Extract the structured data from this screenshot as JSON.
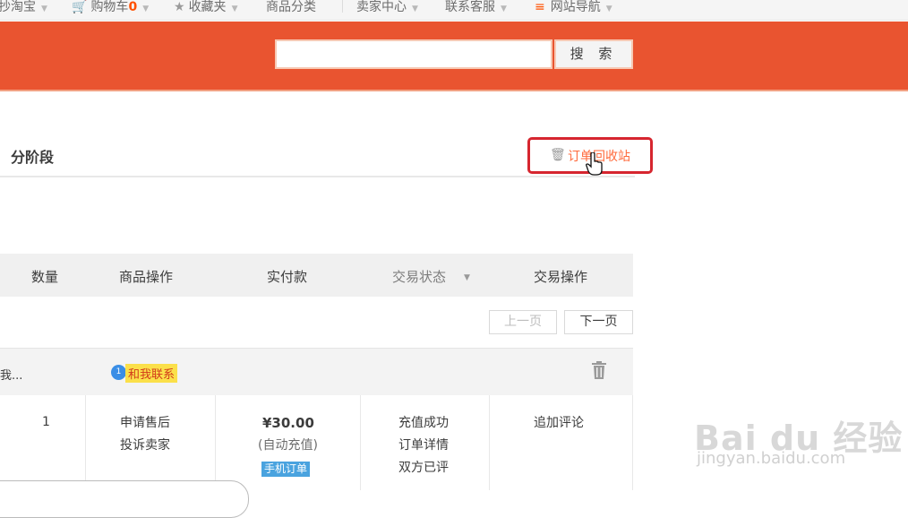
{
  "topnav": {
    "items": [
      {
        "label": "抄淘宝"
      },
      {
        "label": "购物车",
        "count": "0"
      },
      {
        "label": "收藏夹"
      },
      {
        "label": "商品分类"
      },
      {
        "label": "卖家中心"
      },
      {
        "label": "联系客服"
      },
      {
        "label": "网站导航"
      }
    ]
  },
  "search": {
    "button_label": "搜 索",
    "value": ""
  },
  "page_title": "分阶段",
  "recycle_bin_label": "订单回收站",
  "table": {
    "headers": [
      "数量",
      "商品操作",
      "实付款",
      "交易状态",
      "交易操作"
    ]
  },
  "pagination": {
    "prev": "上一页",
    "next": "下一页"
  },
  "order": {
    "seller_text": "我...",
    "contact_label": "和我联系",
    "quantity": "1",
    "item_actions": [
      "申请售后",
      "投诉卖家"
    ],
    "price": "¥30.00",
    "price_note": "(自动充值)",
    "mobile_tag": "手机订单",
    "status_lines": [
      "充值成功",
      "订单详情",
      "双方已评"
    ],
    "trade_action": "追加评论"
  },
  "watermark": {
    "brand": "Bai du 经验",
    "url": "jingyan.baidu.com"
  },
  "colors": {
    "brand_orange": "#e95430",
    "highlight_red": "#d6262f",
    "link_orange": "#ff6a3b"
  }
}
